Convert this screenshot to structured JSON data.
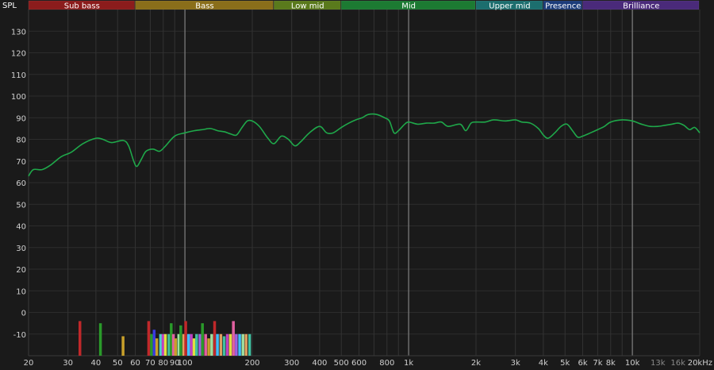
{
  "axis_title_y": "SPL",
  "bands": [
    {
      "label": "Sub bass",
      "from": 20,
      "to": 60,
      "color": "#8b1c1c"
    },
    {
      "label": "Bass",
      "from": 60,
      "to": 250,
      "color": "#8a6e1a"
    },
    {
      "label": "Low mid",
      "from": 250,
      "to": 500,
      "color": "#5a7a1c"
    },
    {
      "label": "Mid",
      "from": 500,
      "to": 2000,
      "color": "#1c7a32"
    },
    {
      "label": "Upper mid",
      "from": 2000,
      "to": 4000,
      "color": "#1c6e6e"
    },
    {
      "label": "Presence",
      "from": 4000,
      "to": 6000,
      "color": "#1c3c7a"
    },
    {
      "label": "Brilliance",
      "from": 6000,
      "to": 20000,
      "color": "#4a2a7a"
    }
  ],
  "chart_data": {
    "type": "line",
    "ylabel": "SPL",
    "xlabel": "",
    "x_scale": "log",
    "xlim": [
      20,
      20000
    ],
    "ylim": [
      -20,
      140
    ],
    "y_ticks": [
      -10,
      0,
      10,
      20,
      30,
      40,
      50,
      60,
      70,
      80,
      90,
      100,
      110,
      120,
      130
    ],
    "x_ticks": [
      {
        "v": 20,
        "label": "20"
      },
      {
        "v": 30,
        "label": "30"
      },
      {
        "v": 40,
        "label": "40"
      },
      {
        "v": 50,
        "label": "50"
      },
      {
        "v": 60,
        "label": "60"
      },
      {
        "v": 70,
        "label": "70"
      },
      {
        "v": 80,
        "label": "80"
      },
      {
        "v": 90,
        "label": "90"
      },
      {
        "v": 100,
        "label": "100"
      },
      {
        "v": 200,
        "label": "200"
      },
      {
        "v": 300,
        "label": "300"
      },
      {
        "v": 400,
        "label": "400"
      },
      {
        "v": 500,
        "label": "500"
      },
      {
        "v": 600,
        "label": "600"
      },
      {
        "v": 800,
        "label": "800"
      },
      {
        "v": 1000,
        "label": "1k"
      },
      {
        "v": 2000,
        "label": "2k"
      },
      {
        "v": 3000,
        "label": "3k"
      },
      {
        "v": 4000,
        "label": "4k"
      },
      {
        "v": 5000,
        "label": "5k"
      },
      {
        "v": 6000,
        "label": "6k"
      },
      {
        "v": 7000,
        "label": "7k"
      },
      {
        "v": 8000,
        "label": "8k"
      },
      {
        "v": 10000,
        "label": "10k"
      },
      {
        "v": 13000,
        "label": "13k",
        "dim": true
      },
      {
        "v": 16000,
        "label": "16k",
        "dim": true
      },
      {
        "v": 20000,
        "label": "20kHz"
      }
    ],
    "major_x": [
      100,
      1000,
      10000
    ],
    "series": [
      {
        "color": "#1fa84a",
        "points": [
          [
            20,
            63
          ],
          [
            21,
            66
          ],
          [
            23,
            66
          ],
          [
            25,
            68
          ],
          [
            28,
            72
          ],
          [
            31,
            74
          ],
          [
            35,
            78
          ],
          [
            40,
            80.5
          ],
          [
            43,
            80
          ],
          [
            47,
            78.5
          ],
          [
            53,
            79.5
          ],
          [
            56,
            77
          ],
          [
            59,
            70
          ],
          [
            61,
            67.5
          ],
          [
            64,
            71
          ],
          [
            67,
            74.5
          ],
          [
            72,
            75.5
          ],
          [
            77,
            74.5
          ],
          [
            82,
            77
          ],
          [
            90,
            81.5
          ],
          [
            100,
            83
          ],
          [
            110,
            84
          ],
          [
            120,
            84.5
          ],
          [
            130,
            85
          ],
          [
            140,
            84
          ],
          [
            150,
            83.5
          ],
          [
            160,
            82.5
          ],
          [
            170,
            82
          ],
          [
            180,
            85.5
          ],
          [
            190,
            88.5
          ],
          [
            200,
            88.5
          ],
          [
            215,
            86
          ],
          [
            235,
            80.5
          ],
          [
            250,
            78
          ],
          [
            270,
            81.5
          ],
          [
            290,
            80
          ],
          [
            310,
            77
          ],
          [
            330,
            79
          ],
          [
            360,
            83
          ],
          [
            400,
            86
          ],
          [
            430,
            83
          ],
          [
            460,
            83
          ],
          [
            500,
            85.5
          ],
          [
            540,
            87.5
          ],
          [
            580,
            89
          ],
          [
            620,
            90
          ],
          [
            660,
            91.5
          ],
          [
            720,
            91.5
          ],
          [
            780,
            90
          ],
          [
            820,
            88.5
          ],
          [
            860,
            83
          ],
          [
            900,
            84
          ],
          [
            960,
            87
          ],
          [
            1000,
            88
          ],
          [
            1100,
            87
          ],
          [
            1200,
            87.5
          ],
          [
            1300,
            87.5
          ],
          [
            1400,
            88
          ],
          [
            1500,
            86
          ],
          [
            1700,
            87
          ],
          [
            1800,
            84
          ],
          [
            1900,
            87.5
          ],
          [
            2000,
            88
          ],
          [
            2200,
            88
          ],
          [
            2400,
            89
          ],
          [
            2700,
            88.5
          ],
          [
            3000,
            89
          ],
          [
            3200,
            88
          ],
          [
            3500,
            87.5
          ],
          [
            3800,
            85
          ],
          [
            4000,
            82
          ],
          [
            4200,
            80.5
          ],
          [
            4500,
            83
          ],
          [
            4800,
            86
          ],
          [
            5100,
            87
          ],
          [
            5400,
            84
          ],
          [
            5700,
            81
          ],
          [
            6000,
            81.5
          ],
          [
            6500,
            83
          ],
          [
            7000,
            84.5
          ],
          [
            7500,
            86
          ],
          [
            8000,
            88
          ],
          [
            9000,
            89
          ],
          [
            10000,
            88.5
          ],
          [
            11000,
            87
          ],
          [
            12000,
            86
          ],
          [
            13000,
            86
          ],
          [
            14000,
            86.5
          ],
          [
            15000,
            87
          ],
          [
            16000,
            87.5
          ],
          [
            17000,
            86.5
          ],
          [
            18000,
            84.5
          ],
          [
            19000,
            85.5
          ],
          [
            20000,
            83
          ]
        ]
      }
    ],
    "bars": [
      {
        "f": 34,
        "top": -4,
        "color": "#c0282a"
      },
      {
        "f": 42,
        "top": -5,
        "color": "#2a9a2a"
      },
      {
        "f": 53,
        "top": -11,
        "color": "#c8a02a"
      },
      {
        "f": 69,
        "top": -4,
        "color": "#c0282a"
      },
      {
        "f": 71,
        "top": -10,
        "color": "#2a9a2a"
      },
      {
        "f": 73,
        "top": -8,
        "color": "#3a3ae0"
      },
      {
        "f": 75,
        "top": -12,
        "color": "#c8a02a"
      },
      {
        "f": 78,
        "top": -10,
        "color": "#4ad0d0"
      },
      {
        "f": 80,
        "top": -10,
        "color": "#c040c0"
      },
      {
        "f": 82,
        "top": -10,
        "color": "#e0e040"
      },
      {
        "f": 85,
        "top": -10,
        "color": "#40c0a0"
      },
      {
        "f": 87,
        "top": -5,
        "color": "#2a9a2a"
      },
      {
        "f": 89,
        "top": -10,
        "color": "#e060a0"
      },
      {
        "f": 91,
        "top": -12,
        "color": "#c8a02a"
      },
      {
        "f": 94,
        "top": -10,
        "color": "#a0e0a0"
      },
      {
        "f": 96,
        "top": -6,
        "color": "#2a9a2a"
      },
      {
        "f": 99,
        "top": -10,
        "color": "#e0a060"
      },
      {
        "f": 101,
        "top": -4,
        "color": "#c0282a"
      },
      {
        "f": 104,
        "top": -10,
        "color": "#40c0ff"
      },
      {
        "f": 107,
        "top": -10,
        "color": "#c040c0"
      },
      {
        "f": 110,
        "top": -12,
        "color": "#e0e040"
      },
      {
        "f": 113,
        "top": -10,
        "color": "#40c0a0"
      },
      {
        "f": 117,
        "top": -10,
        "color": "#a060e0"
      },
      {
        "f": 120,
        "top": -5,
        "color": "#2a9a2a"
      },
      {
        "f": 124,
        "top": -10,
        "color": "#e060a0"
      },
      {
        "f": 128,
        "top": -12,
        "color": "#c8a02a"
      },
      {
        "f": 132,
        "top": -10,
        "color": "#a0e0a0"
      },
      {
        "f": 136,
        "top": -4,
        "color": "#c0282a"
      },
      {
        "f": 140,
        "top": -10,
        "color": "#40c0ff"
      },
      {
        "f": 145,
        "top": -10,
        "color": "#e0a060"
      },
      {
        "f": 150,
        "top": -11,
        "color": "#40c0a0"
      },
      {
        "f": 155,
        "top": -10,
        "color": "#c040c0"
      },
      {
        "f": 160,
        "top": -10,
        "color": "#e0e040"
      },
      {
        "f": 165,
        "top": -4,
        "color": "#e060a0"
      },
      {
        "f": 170,
        "top": -10,
        "color": "#a060e0"
      },
      {
        "f": 176,
        "top": -10,
        "color": "#40c0ff"
      },
      {
        "f": 182,
        "top": -10,
        "color": "#a0e0a0"
      },
      {
        "f": 188,
        "top": -10,
        "color": "#e0a060"
      },
      {
        "f": 195,
        "top": -10,
        "color": "#40c0a0"
      }
    ]
  }
}
